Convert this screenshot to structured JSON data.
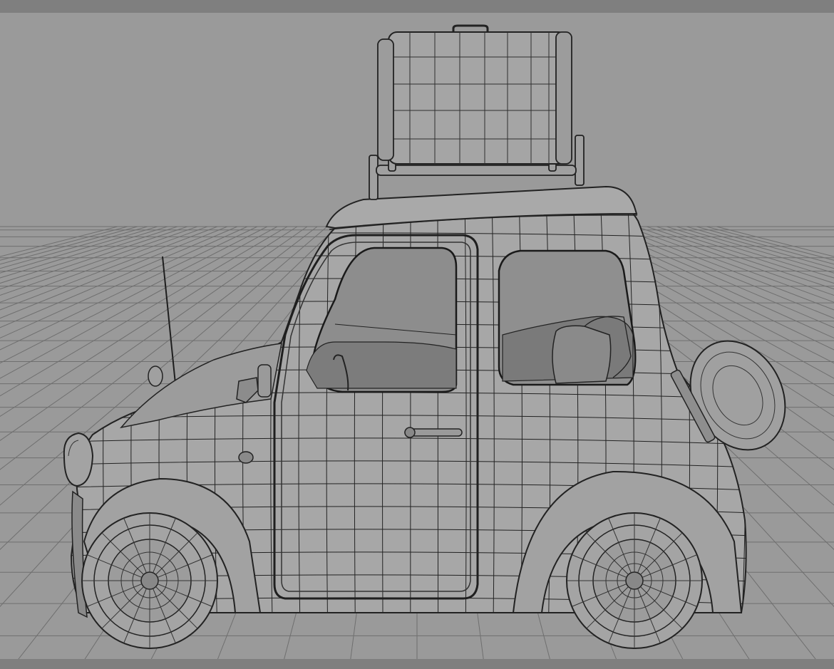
{
  "viewport": {
    "background_color": "#9a9a9a",
    "frame_color": "#7f7f7f",
    "grid_color": "#6f6f6f",
    "wire_color": "#222222",
    "body_color": "#a6a6a6"
  },
  "scene": {
    "object": "car-wireframe-model",
    "parts": [
      "body",
      "roof-rack",
      "suitcase",
      "front-wheel",
      "rear-wheel",
      "spare-tire",
      "antenna",
      "front-door",
      "rear-window",
      "seats",
      "door-handle",
      "headlight",
      "mirror"
    ]
  }
}
